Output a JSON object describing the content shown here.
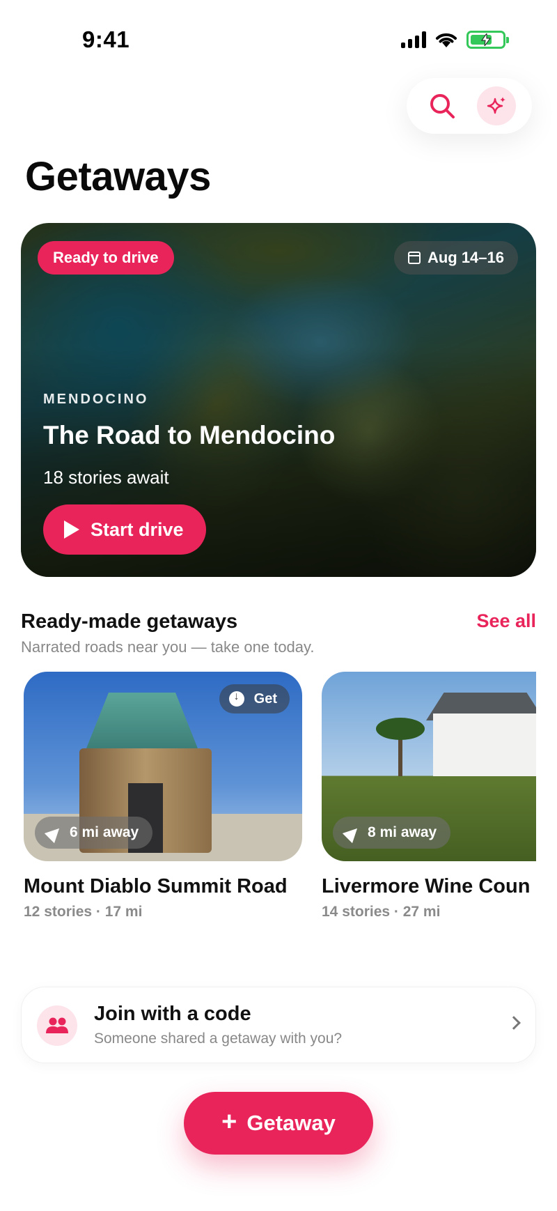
{
  "status_bar": {
    "time": "9:41"
  },
  "header": {
    "title": "Getaways"
  },
  "hero": {
    "badge": "Ready to drive",
    "date": "Aug 14–16",
    "region": "MENDOCINO",
    "title": "The Road to Mendocino",
    "subtitle": "18 stories await",
    "cta": "Start drive"
  },
  "ready_made": {
    "title": "Ready-made getaways",
    "see_all": "See all",
    "subtitle": "Narrated roads near you — take one today.",
    "items": [
      {
        "name": "Mount Diablo Summit Road",
        "distance": "6 mi away",
        "meta": "12 stories · 17 mi",
        "get_label": "Get"
      },
      {
        "name": "Livermore Wine Coun",
        "distance": "8 mi away",
        "meta": "14 stories · 27 mi",
        "get_label": ""
      }
    ]
  },
  "join": {
    "title": "Join with a code",
    "subtitle": "Someone shared a getaway with you?"
  },
  "add_button": {
    "label": "Getaway"
  },
  "colors": {
    "accent": "#e8245a",
    "accent_soft": "#fde3ea",
    "battery": "#34c759"
  }
}
